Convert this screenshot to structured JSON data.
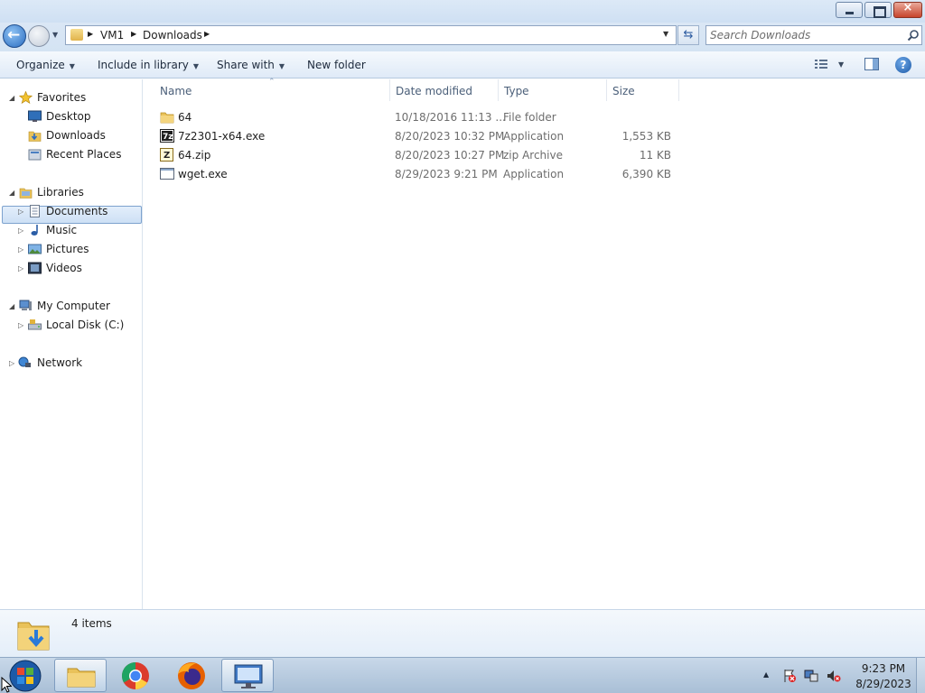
{
  "window": {
    "minimize_glyph": "",
    "close_glyph": "×"
  },
  "address": {
    "crumbs": [
      "VM1",
      "Downloads"
    ],
    "search_placeholder": "Search Downloads"
  },
  "toolbar": {
    "organize": "Organize",
    "include_in_library": "Include in library",
    "share_with": "Share with",
    "new_folder": "New folder"
  },
  "nav": {
    "favorites": "Favorites",
    "desktop": "Desktop",
    "downloads": "Downloads",
    "recent_places": "Recent Places",
    "libraries": "Libraries",
    "documents": "Documents",
    "music": "Music",
    "pictures": "Pictures",
    "videos": "Videos",
    "my_computer": "My Computer",
    "local_disk": "Local Disk (C:)",
    "network": "Network"
  },
  "columns": {
    "name": "Name",
    "date_modified": "Date modified",
    "type": "Type",
    "size": "Size"
  },
  "files": [
    {
      "name": "64",
      "date": "10/18/2016 11:13 ...",
      "type": "File folder",
      "size": "",
      "icon": "folder-icon"
    },
    {
      "name": "7z2301-x64.exe",
      "date": "8/20/2023 10:32 PM",
      "type": "Application",
      "size": "1,553 KB",
      "icon": "7zip-app-icon"
    },
    {
      "name": "64.zip",
      "date": "8/20/2023 10:27 PM",
      "type": "zip Archive",
      "size": "11 KB",
      "icon": "zip-archive-icon"
    },
    {
      "name": "wget.exe",
      "date": "8/29/2023 9:21 PM",
      "type": "Application",
      "size": "6,390 KB",
      "icon": "application-icon"
    }
  ],
  "status": {
    "items_count": "4 items"
  },
  "taskbar": {
    "apps": [
      "windows-explorer-icon",
      "chrome-icon",
      "firefox-icon",
      "remote-desktop-icon"
    ],
    "time": "9:23 PM",
    "date": "8/29/2023"
  },
  "colors": {
    "selection": "#cde0f5",
    "chrome_blue": "#2a6cc0",
    "folder_yellow": "#e1b34b"
  }
}
